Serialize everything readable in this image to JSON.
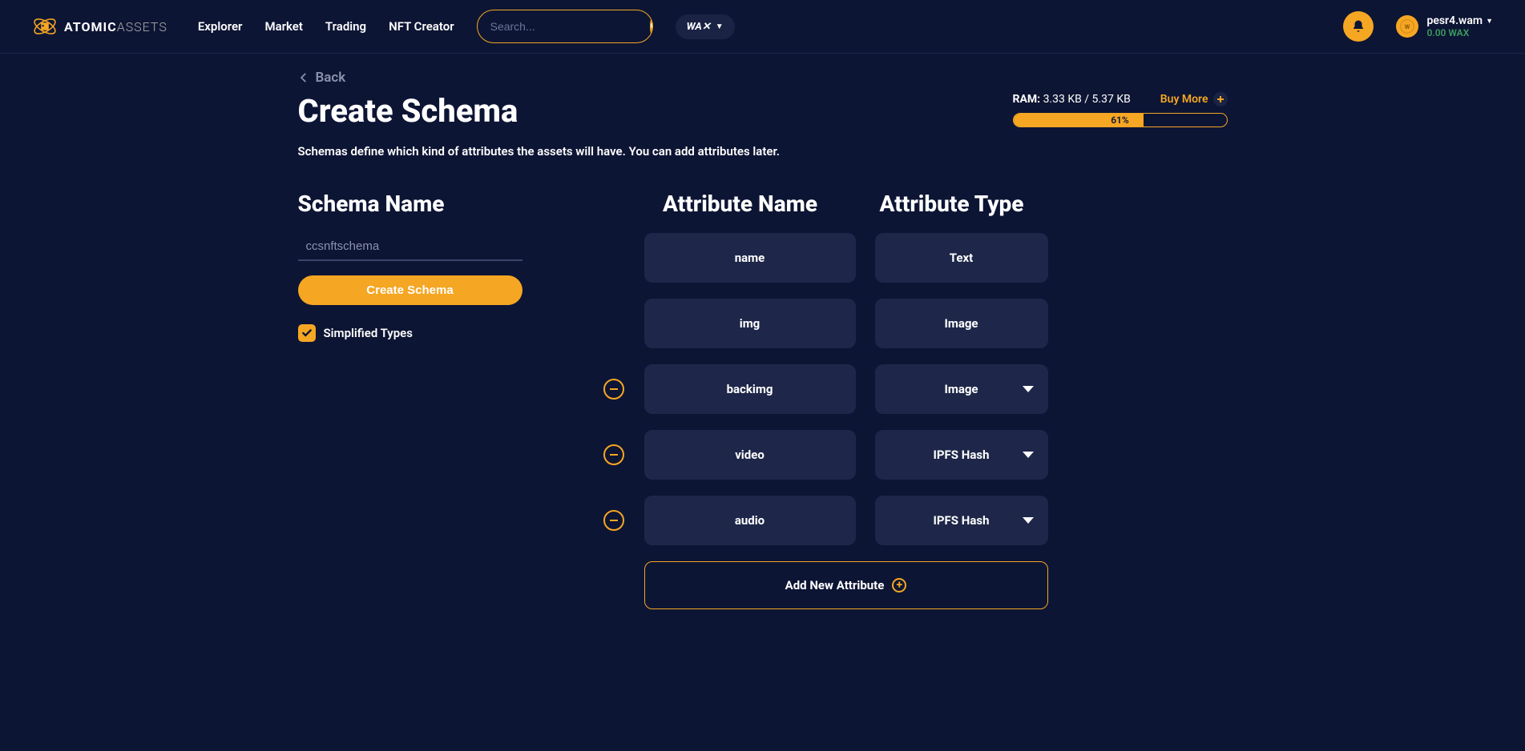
{
  "logo": {
    "bold": "ATOMIC",
    "light": "ASSETS"
  },
  "nav": [
    "Explorer",
    "Market",
    "Trading",
    "NFT Creator"
  ],
  "search": {
    "placeholder": "Search..."
  },
  "chain_label": "WA✕",
  "user": {
    "name": "pesr4.wam",
    "balance": "0.00 WAX"
  },
  "back_label": "Back",
  "page_title": "Create Schema",
  "page_desc": "Schemas define which kind of attributes the assets will have. You can add attributes later.",
  "ram": {
    "label": "RAM:",
    "value": "3.33 KB / 5.37 KB",
    "buy_more": "Buy More",
    "percent": "61%"
  },
  "schema": {
    "heading": "Schema Name",
    "value": "ccsnftschema",
    "create_btn": "Create Schema",
    "simplified_label": "Simplified Types"
  },
  "attr_headers": {
    "name": "Attribute Name",
    "type": "Attribute Type"
  },
  "attributes": [
    {
      "name": "name",
      "type": "Text",
      "removable": false,
      "dropdown": false
    },
    {
      "name": "img",
      "type": "Image",
      "removable": false,
      "dropdown": false
    },
    {
      "name": "backimg",
      "type": "Image",
      "removable": true,
      "dropdown": true
    },
    {
      "name": "video",
      "type": "IPFS Hash",
      "removable": true,
      "dropdown": true
    },
    {
      "name": "audio",
      "type": "IPFS Hash",
      "removable": true,
      "dropdown": true
    }
  ],
  "add_attr_label": "Add New Attribute"
}
